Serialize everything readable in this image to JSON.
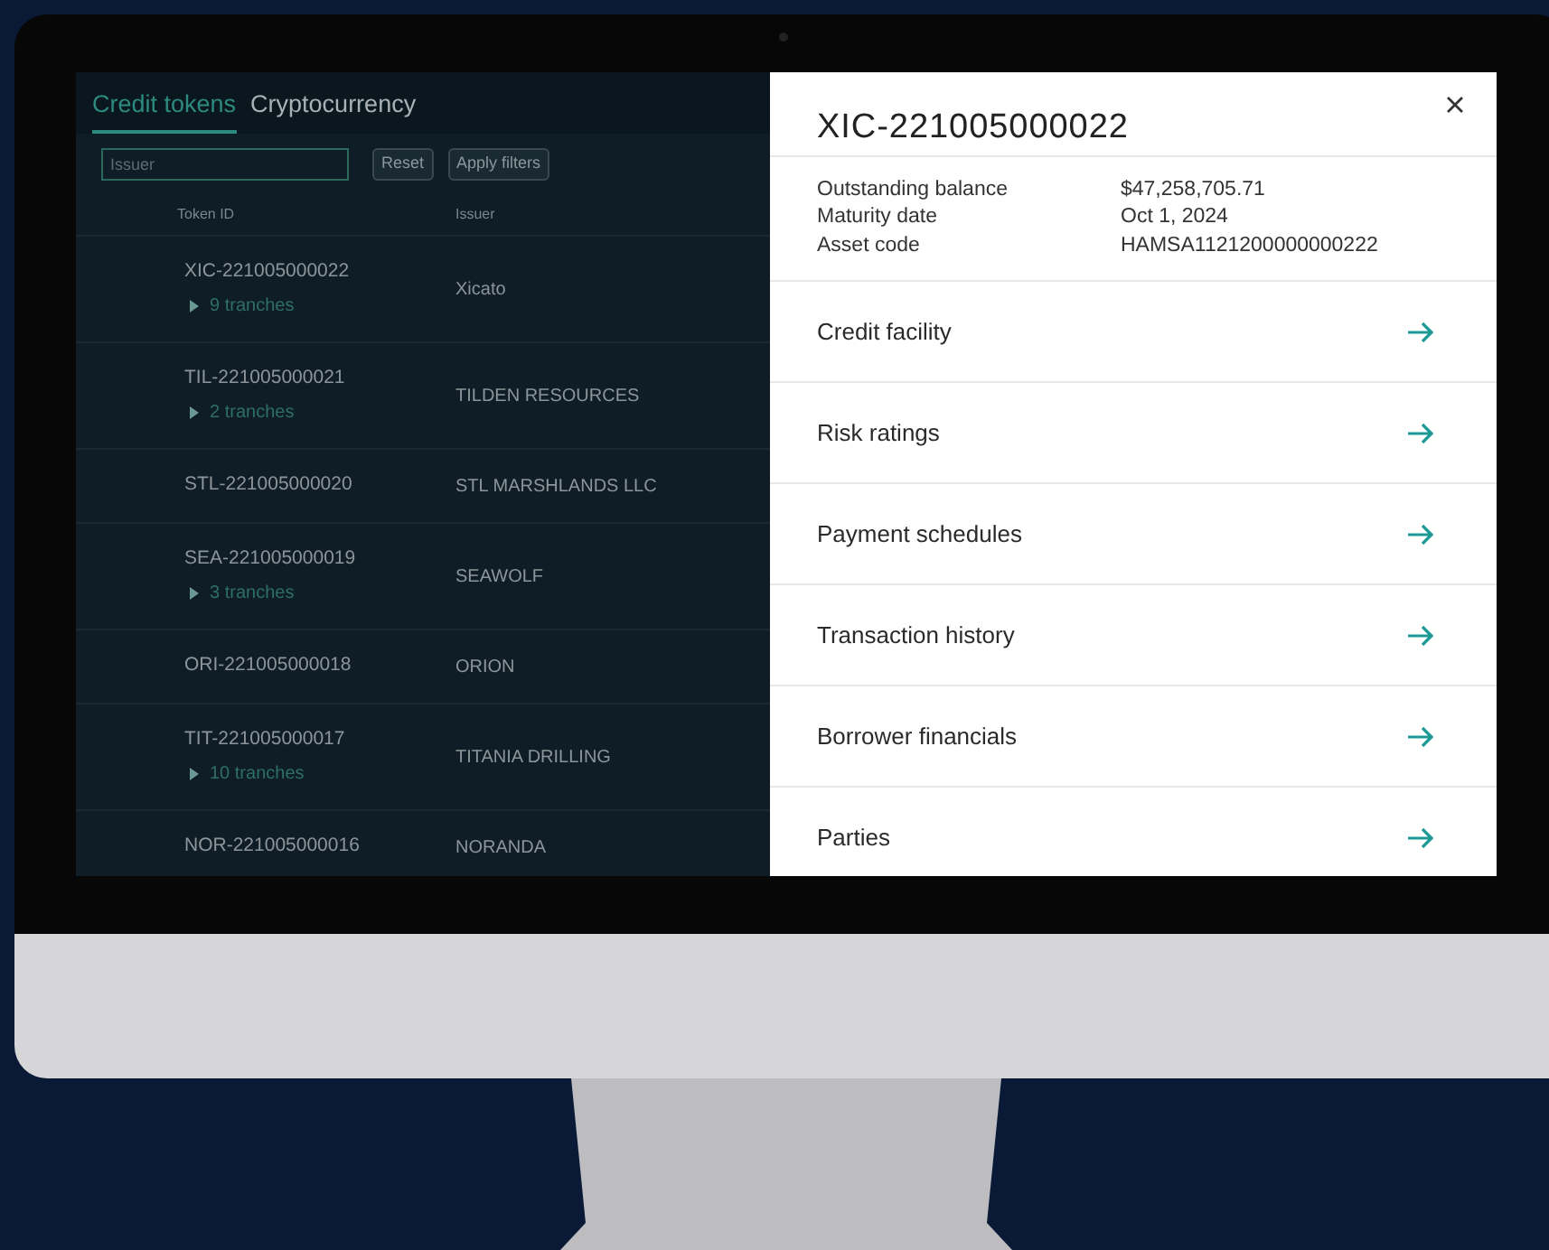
{
  "tabs": [
    {
      "label": "Credit tokens",
      "selected": true
    },
    {
      "label": "Cryptocurrency",
      "selected": false
    }
  ],
  "filters": {
    "placeholder": "Issuer",
    "buttons": [
      "Reset",
      "Apply filters"
    ]
  },
  "table": {
    "columns": [
      "Token ID",
      "Issuer"
    ],
    "rows": [
      {
        "token_id": "XIC-221005000022",
        "tranches": "9 tranches",
        "issuer": "Xicato"
      },
      {
        "token_id": "TIL-221005000021",
        "tranches": "2 tranches",
        "issuer": "TILDEN RESOURCES"
      },
      {
        "token_id": "STL-221005000020",
        "issuer": "STL MARSHLANDS LLC"
      },
      {
        "token_id": "SEA-221005000019",
        "tranches": "3 tranches",
        "issuer": "SEAWOLF"
      },
      {
        "token_id": "ORI-221005000018",
        "issuer": "ORION"
      },
      {
        "token_id": "TIT-221005000017",
        "tranches": "10 tranches",
        "issuer": "TITANIA DRILLING"
      },
      {
        "token_id": "NOR-221005000016",
        "issuer": "NORANDA"
      }
    ]
  },
  "detail_panel": {
    "title": "XIC-221005000022",
    "fields": [
      {
        "label": "Outstanding balance",
        "value": "$47,258,705.71"
      },
      {
        "label": "Maturity date",
        "value": "Oct 1, 2024"
      },
      {
        "label": "Asset code",
        "value": "HAMSA1121200000000222"
      }
    ],
    "sections": [
      "Credit facility",
      "Risk ratings",
      "Payment schedules",
      "Transaction history",
      "Borrower financials",
      "Parties"
    ]
  }
}
